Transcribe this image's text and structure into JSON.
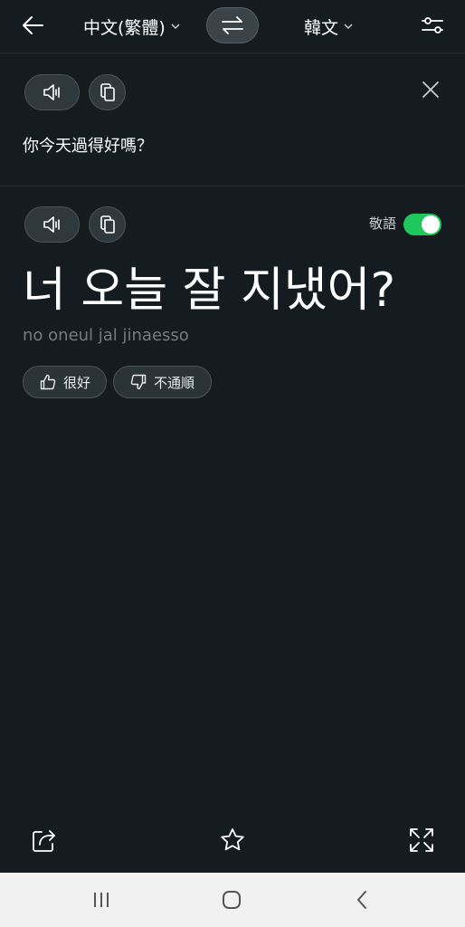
{
  "header": {
    "source_language": "中文(繁體)",
    "target_language": "韓文",
    "icons": {
      "back": "arrow-left-icon",
      "swap": "swap-arrows-icon",
      "settings": "sliders-icon"
    }
  },
  "source": {
    "text": "你今天過得好嗎？"
  },
  "target": {
    "honorific_label": "敬語",
    "honorific_enabled": true,
    "text": "너 오늘 잘 지냈어?",
    "romanization": "no oneul jal jinaesso"
  },
  "feedback": {
    "good_label": "很好",
    "bad_label": "不通順"
  },
  "colors": {
    "background": "#141c1f",
    "toggle_on": "#1ec85b",
    "pill_bg": "#2f393d",
    "muted_text": "#737d81",
    "nav_bar": "#f1f1f1"
  }
}
